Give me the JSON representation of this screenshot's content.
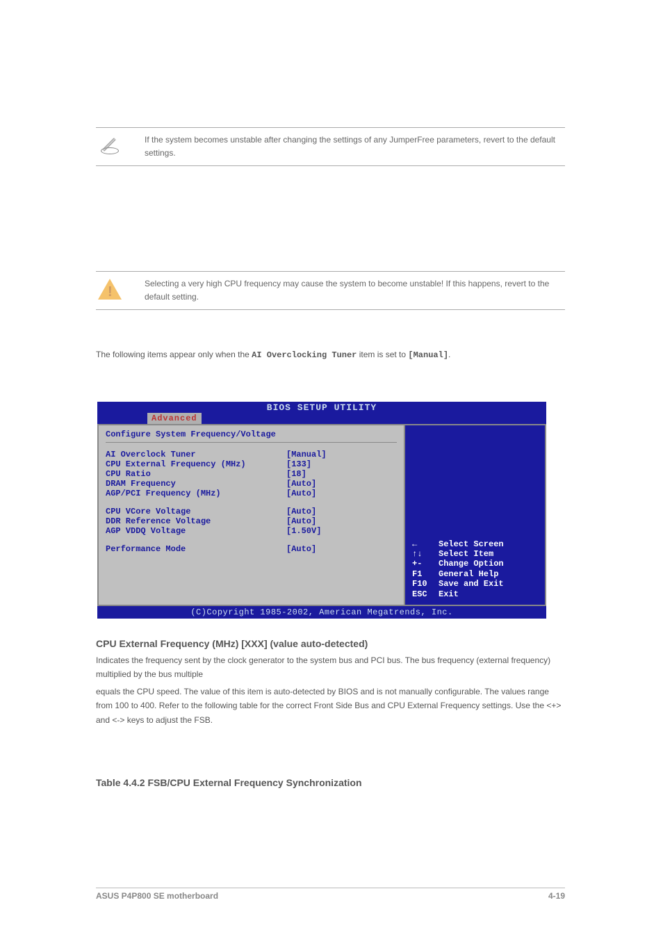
{
  "note1_text": "If the system becomes unstable after changing the settings of any JumperFree parameters, revert to the default settings.",
  "note2_text": "Selecting a very high CPU frequency may cause the system to become unstable! If this happens, revert to the default setting.",
  "intro_text_1": "The following items appear only when the ",
  "intro_text_2": "AI Overclocking Tuner",
  "intro_text_3": " item is set to ",
  "intro_text_4": "[Manual]",
  "intro_text_5": ".",
  "bios": {
    "title": "BIOS SETUP UTILITY",
    "tab": "Advanced",
    "heading": "Configure System Frequency/Voltage",
    "rows_a": [
      {
        "label": "AI Overclock Tuner",
        "value": "[Manual]"
      },
      {
        "label": "CPU External Frequency (MHz)",
        "value": "[133]"
      },
      {
        "label": "CPU Ratio",
        "value": "[18]"
      },
      {
        "label": "DRAM Frequency",
        "value": "[Auto]"
      },
      {
        "label": "AGP/PCI Frequency (MHz)",
        "value": "[Auto]"
      }
    ],
    "rows_b": [
      {
        "label": "CPU VCore Voltage",
        "value": "[Auto]"
      },
      {
        "label": "DDR Reference Voltage",
        "value": "[Auto]"
      },
      {
        "label": "AGP VDDQ Voltage",
        "value": "[1.50V]"
      }
    ],
    "rows_c": [
      {
        "label": "Performance Mode",
        "value": "[Auto]"
      }
    ],
    "help": [
      {
        "key": "←",
        "text": "Select Screen"
      },
      {
        "key": "↑↓",
        "text": "Select Item"
      },
      {
        "key": "+-",
        "text": "Change Option"
      },
      {
        "key": "F1",
        "text": "General Help"
      },
      {
        "key": "F10",
        "text": "Save and Exit"
      },
      {
        "key": "ESC",
        "text": "Exit"
      }
    ],
    "footer": "(C)Copyright 1985-2002, American Megatrends, Inc."
  },
  "sections": {
    "s1": {
      "title": "CPU External Frequency (MHz) [XXX] (value auto-detected)",
      "body": "Indicates the frequency sent by the clock generator to the system bus and PCI bus. The bus frequency (external frequency) multiplied by the bus multiple"
    },
    "s2": {
      "title": "",
      "body": "equals the CPU speed. The value of this item is auto-detected by BIOS and is not manually configurable. The values range from 100 to 400. Refer to the following table for the correct Front Side Bus and CPU External Frequency settings. Use the <+> and <-> keys to adjust the FSB."
    },
    "s3": {
      "title": "Table 4.4.2   FSB/CPU External Frequency Synchronization",
      "body": ""
    }
  },
  "footer": {
    "left": "ASUS P4P800 SE motherboard",
    "right": "4-19"
  }
}
